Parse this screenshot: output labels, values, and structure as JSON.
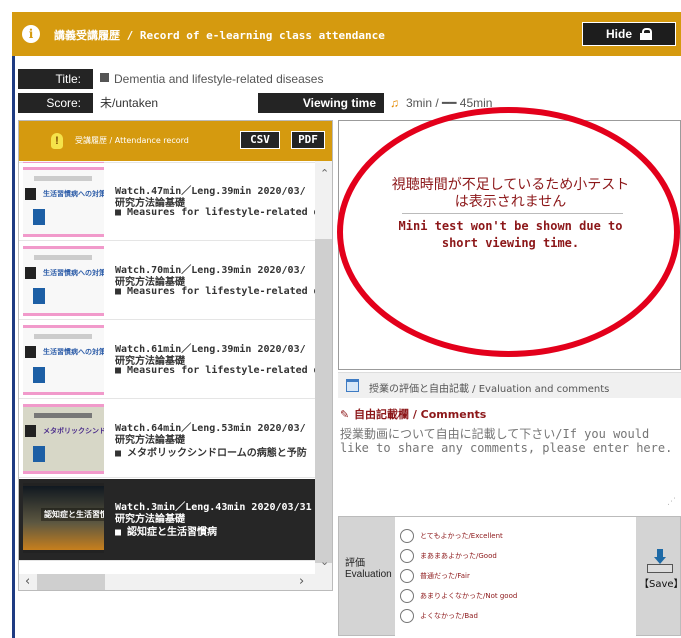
{
  "header": {
    "title": "講義受講履歴 / Record of e-learning class attendance",
    "hide_label": "Hide"
  },
  "details": {
    "title_label": "Title:",
    "title_value": "Dementia and lifestyle-related diseases",
    "score_label": "Score:",
    "score_value": "未/untaken",
    "viewing_label": "Viewing time",
    "viewing_value": "3min / ━━ 45min"
  },
  "record": {
    "title": "受講履歴 / Attendance record",
    "csv_label": "CSV",
    "pdf_label": "PDF",
    "items": [
      {
        "watch": "Watch.47min／Leng.39min  2020/03/",
        "method": "研究方法論基礎",
        "title": "■ Measures for lifestyle-related dis",
        "thumb": "生活習慣病への対策"
      },
      {
        "watch": "Watch.70min／Leng.39min  2020/03/",
        "method": "研究方法論基礎",
        "title": "■ Measures for lifestyle-related dis",
        "thumb": "生活習慣病への対策"
      },
      {
        "watch": "Watch.61min／Leng.39min  2020/03/",
        "method": "研究方法論基礎",
        "title": "■ Measures for lifestyle-related dis",
        "thumb": "生活習慣病への対策"
      },
      {
        "watch": "Watch.64min／Leng.53min  2020/03/",
        "method": "研究方法論基礎",
        "title": "■ メタボリックシンドロームの病態と予防",
        "thumb": "メタボリックシンドロームの病態と予防"
      },
      {
        "watch": "Watch.3min／Leng.43min  2020/03/31",
        "method": "研究方法論基礎",
        "title": "■ 認知症と生活習慣病",
        "thumb": "認知症と生活習慣病"
      }
    ]
  },
  "video": {
    "message_jp": "視聴時間が不足しているため小テスト\nは表示されません",
    "message_en": "Mini test won't be shown due to\nshort viewing time."
  },
  "evaluation": {
    "header": "授業の評価と自由記載  /  Evaluation and comments",
    "comments_title": "自由記載欄  / Comments",
    "comments_placeholder": "授業動画について自由に記載して下さい/If you would like to share any comments, please enter here.",
    "rating_label_jp": "評価",
    "rating_label_en": "Evaluation",
    "options": [
      "とてもよかった/Excellent",
      "まあまあよかった/Good",
      "普通だった/Fair",
      "あまりよくなかった/Not good",
      "よくなかった/Bad"
    ],
    "save_label": "【Save】"
  }
}
